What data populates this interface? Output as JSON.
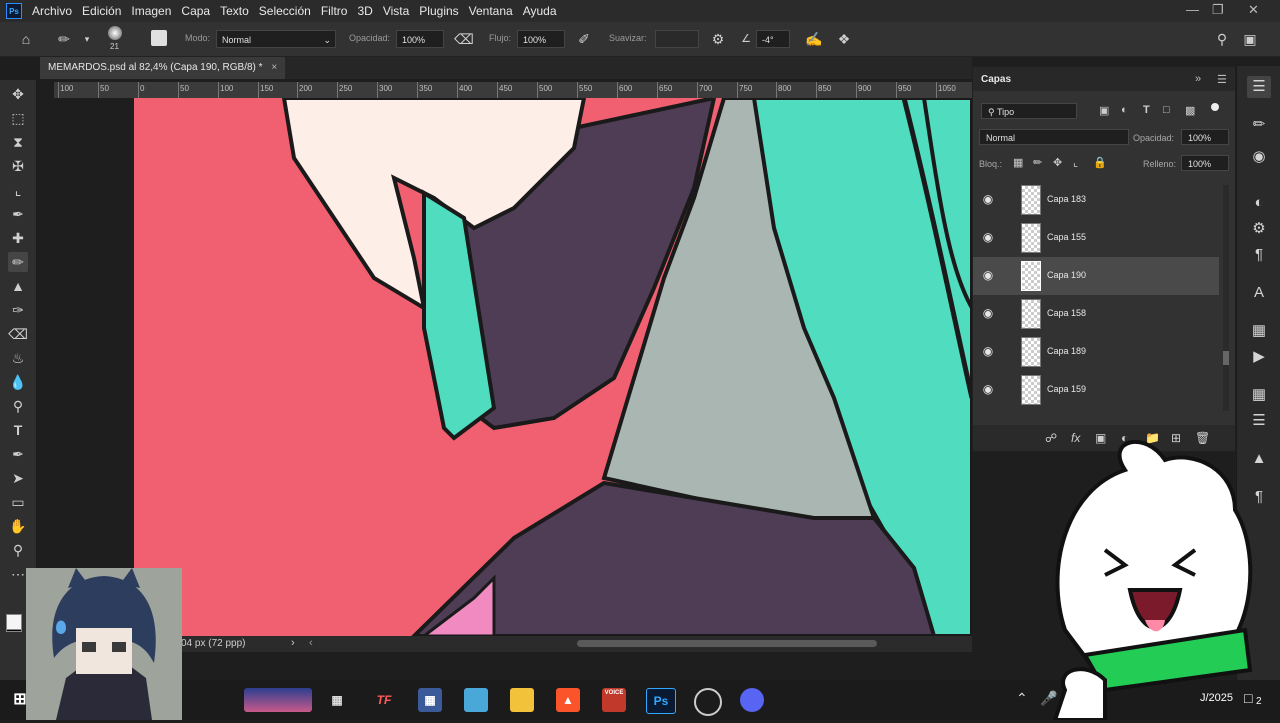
{
  "menu": {
    "app_badge": "Ps",
    "items": [
      "Archivo",
      "Edición",
      "Imagen",
      "Capa",
      "Texto",
      "Selección",
      "Filtro",
      "3D",
      "Vista",
      "Plugins",
      "Ventana",
      "Ayuda"
    ]
  },
  "options": {
    "brush_size": "21",
    "mode_label": "Modo:",
    "mode_value": "Normal",
    "opacity_label": "Opacidad:",
    "opacity_value": "100%",
    "flow_label": "Flujo:",
    "flow_value": "100%",
    "smooth_label": "Suavizar:",
    "angle_value": "-4°"
  },
  "document": {
    "tab_title": "MEMARDOS.psd al 82,4% (Capa 190, RGB/8) *",
    "status": "04 px (72 ppp)"
  },
  "ruler_labels": [
    "100",
    "50",
    "0",
    "50",
    "100",
    "150",
    "200",
    "250",
    "300",
    "350",
    "400",
    "450",
    "500",
    "550",
    "600",
    "650",
    "700",
    "750",
    "800",
    "850",
    "900",
    "950",
    "1050"
  ],
  "layers_panel": {
    "title": "Capas",
    "filter_value": "Tipo",
    "blend_mode": "Normal",
    "opacity_label": "Opacidad:",
    "opacity_value": "100%",
    "lock_label": "Bloq.:",
    "fill_label": "Relleno:",
    "fill_value": "100%",
    "layers": [
      {
        "name": "Capa 183",
        "selected": false
      },
      {
        "name": "Capa 155",
        "selected": false
      },
      {
        "name": "Capa 190",
        "selected": true
      },
      {
        "name": "Capa 158",
        "selected": false
      },
      {
        "name": "Capa 189",
        "selected": false
      },
      {
        "name": "Capa 159",
        "selected": false
      }
    ]
  },
  "taskbar": {
    "date_fragment": "J/2025",
    "notification_count": "2",
    "apps": [
      "game-thumbnail",
      "task-view",
      "tf-app",
      "calculator",
      "notes",
      "file-explorer",
      "brave",
      "voicemeeter",
      "photoshop",
      "media-app",
      "discord"
    ]
  },
  "colors": {
    "canvas_background": "#f06070",
    "teal_hair": "#4fdcbf",
    "shirt_dark": "#4f3d55",
    "shirt_grey": "#a9b6b2",
    "skin": "#fdeee8",
    "accent_blue": "#31a8ff"
  }
}
